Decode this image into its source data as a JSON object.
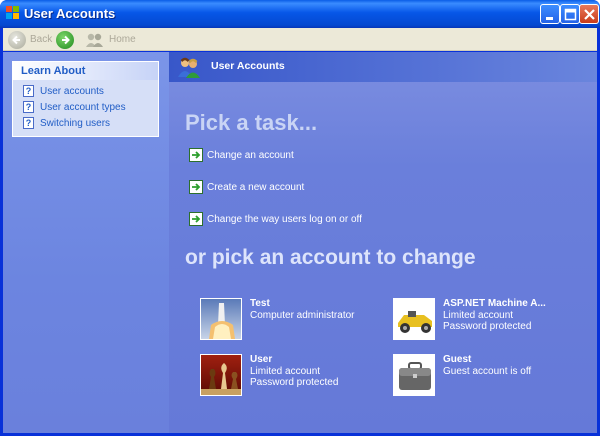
{
  "window": {
    "title": "User Accounts"
  },
  "toolbar": {
    "back_label": "Back",
    "home_label": "Home"
  },
  "learn_about": {
    "title": "Learn About",
    "items": [
      {
        "label": "User accounts"
      },
      {
        "label": "User account types"
      },
      {
        "label": "Switching users"
      }
    ]
  },
  "header": {
    "title": "User Accounts"
  },
  "tasks": {
    "title": "Pick a task...",
    "items": [
      {
        "label": "Change an account"
      },
      {
        "label": "Create a new account"
      },
      {
        "label": "Change the way users log on or off"
      }
    ]
  },
  "accounts": {
    "title": "or pick an account to change",
    "items": [
      {
        "name": "Test",
        "line1": "Computer administrator",
        "line2": "",
        "picture": "rocket-launch-icon"
      },
      {
        "name": "ASP.NET Machine A...",
        "line1": "Limited account",
        "line2": "Password protected",
        "picture": "race-car-icon"
      },
      {
        "name": "User",
        "line1": "Limited account",
        "line2": "Password protected",
        "picture": "chess-pieces-icon"
      },
      {
        "name": "Guest",
        "line1": "Guest account is off",
        "line2": "",
        "picture": "briefcase-icon"
      }
    ]
  },
  "colors": {
    "titlebar": "#0757e8",
    "content_bg": "#6a7fdb",
    "link": "#215dc6",
    "task_arrow": "#2c9f2c"
  }
}
